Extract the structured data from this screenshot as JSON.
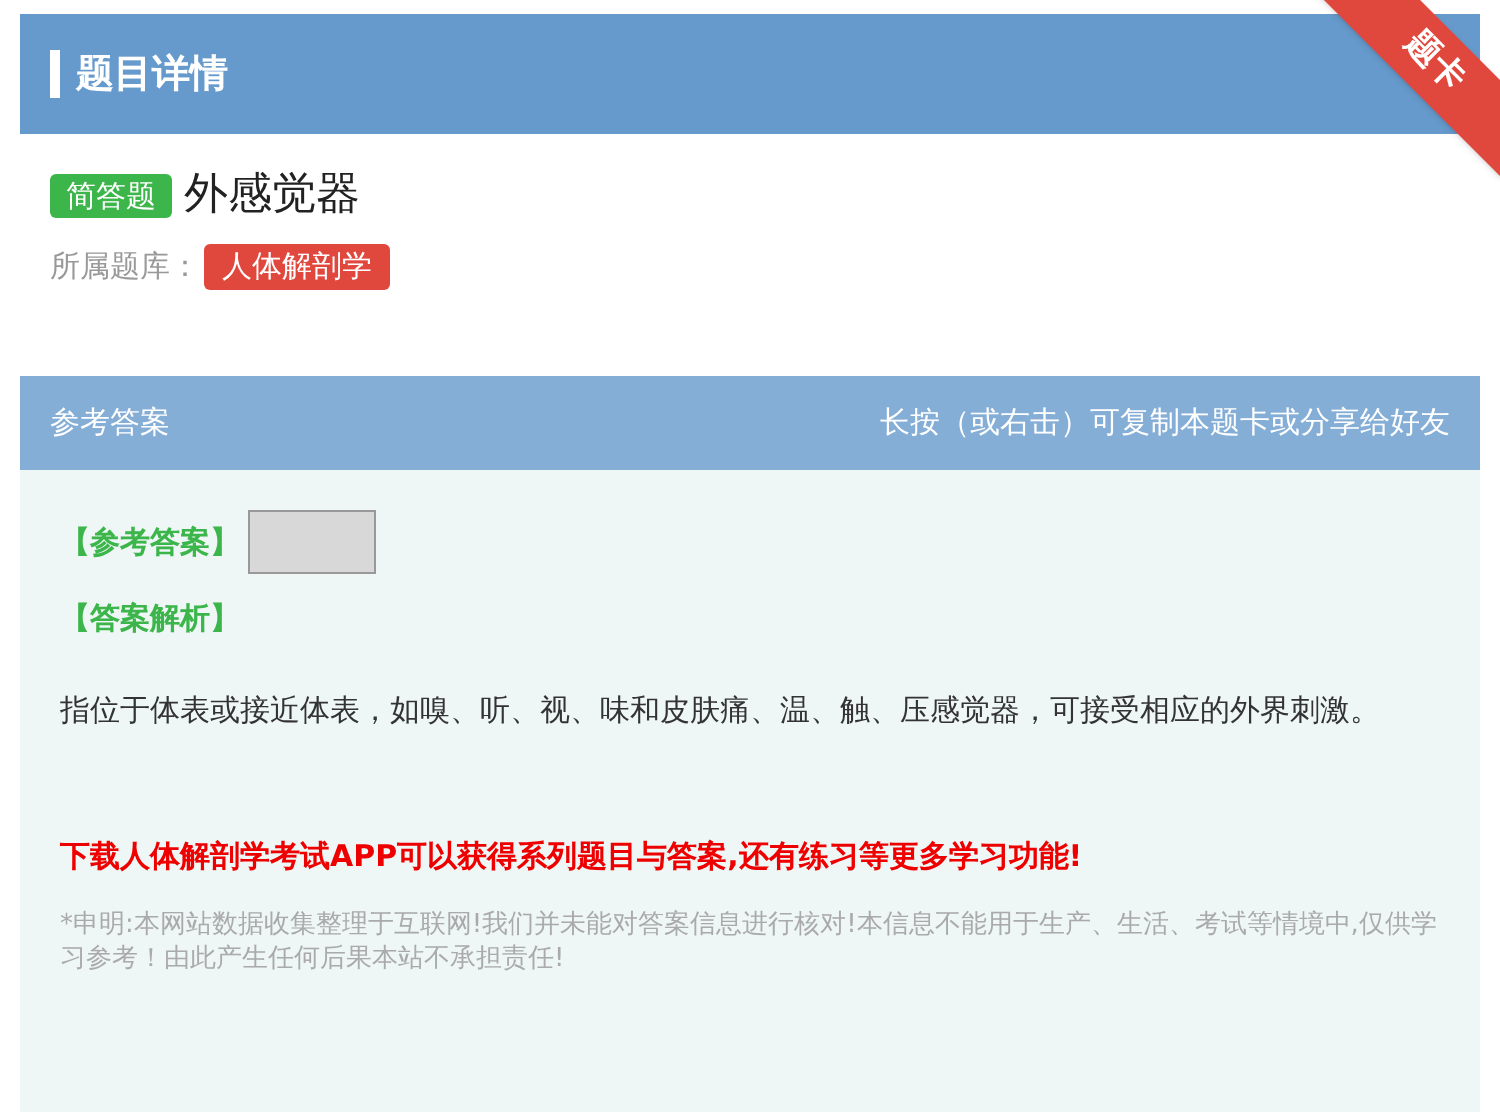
{
  "header": {
    "title": "题目详情",
    "ribbon": "题卡"
  },
  "question": {
    "type_tag": "简答题",
    "title": "外感觉器",
    "library_label": "所属题库：",
    "library_tag": "人体解剖学"
  },
  "answer_panel": {
    "title": "参考答案",
    "hint": "长按（或右击）可复制本题卡或分享给好友",
    "answer_label": "【参考答案】",
    "analysis_label": "【答案解析】",
    "analysis": "指位于体表或接近体表，如嗅、听、视、味和皮肤痛、温、触、压感觉器，可接受相应的外界刺激。",
    "promo": "下载人体解剖学考试APP可以获得系列题目与答案,还有练习等更多学习功能!",
    "disclaimer": "*申明:本网站数据收集整理于互联网!我们并未能对答案信息进行核对!本信息不能用于生产、生活、考试等情境中,仅供学习参考！由此产生任何后果本站不承担责任!"
  }
}
